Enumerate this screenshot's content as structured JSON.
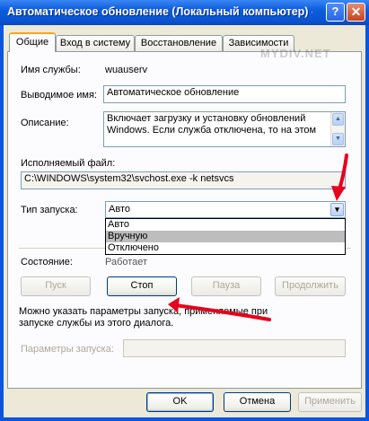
{
  "window": {
    "title": "Автоматическое обновление (Локальный компьютер) - свой...",
    "help_glyph": "?",
    "close_glyph": "✕"
  },
  "tabs": [
    {
      "label": "Общие",
      "active": true
    },
    {
      "label": "Вход в систему",
      "active": false
    },
    {
      "label": "Восстановление",
      "active": false
    },
    {
      "label": "Зависимости",
      "active": false
    }
  ],
  "general": {
    "service_name_label": "Имя службы:",
    "service_name_value": "wuauserv",
    "display_name_label": "Выводимое имя:",
    "display_name_value": "Автоматическое обновление",
    "description_label": "Описание:",
    "description_value": "Включает загрузку и установку обновлений Windows. Если служба отключена, то на этом",
    "executable_label": "Исполняемый файл:",
    "executable_value": "C:\\WINDOWS\\system32\\svchost.exe -k netsvcs",
    "startup_type_label": "Тип запуска:",
    "startup_type_value": "Авто",
    "startup_options": [
      "Авто",
      "Вручную",
      "Отключено"
    ],
    "startup_highlighted": "Вручную",
    "state_label": "Состояние:",
    "state_value": "Работает",
    "hint": "Можно указать параметры запуска, применяемые при запуске службы из этого диалога.",
    "params_label": "Параметры запуска:",
    "params_value": ""
  },
  "service_buttons": {
    "start": "Пуск",
    "stop": "Стоп",
    "pause": "Пауза",
    "resume": "Продолжить"
  },
  "dialog_buttons": {
    "ok": "OK",
    "cancel": "Отмена",
    "apply": "Применить"
  },
  "watermark": "MYDIV.NET",
  "colors": {
    "title_bar": "#0a5ddc",
    "annotation_arrow": "#e8001c",
    "tab_highlight": "#f7a524"
  }
}
